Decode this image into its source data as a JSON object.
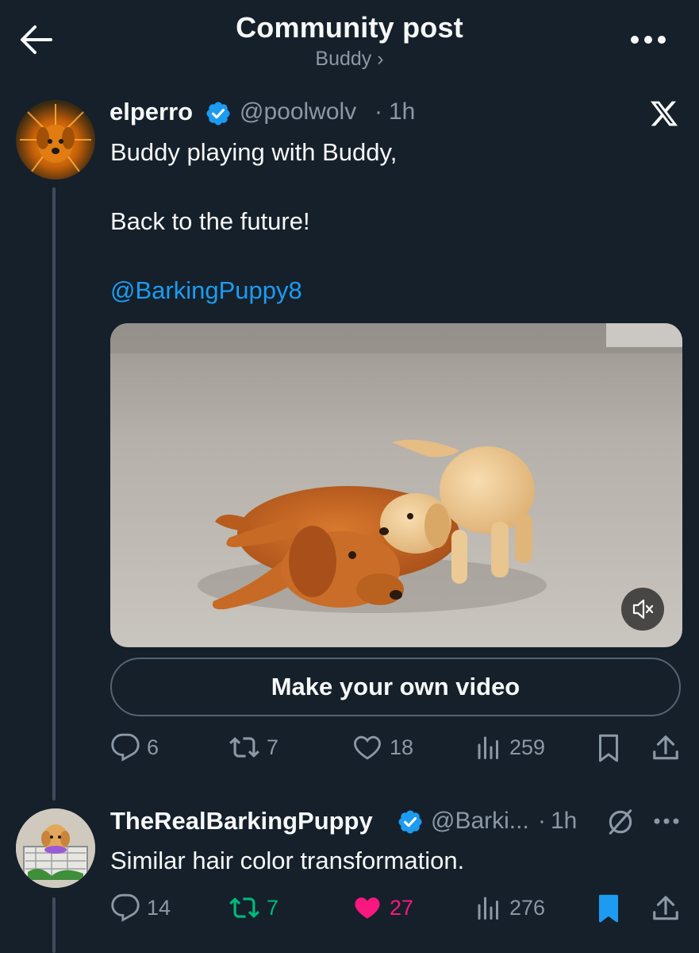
{
  "header": {
    "title": "Community post",
    "community": "Buddy ›"
  },
  "post": {
    "display_name": "elperro",
    "handle": "@poolwolv",
    "separator": "·",
    "time": "1h",
    "text_line1": "Buddy playing with Buddy,",
    "text_line2": "Back to the future!",
    "mention": "@BarkingPuppy8",
    "cta_label": "Make your own video",
    "stats": {
      "replies": "6",
      "reposts": "7",
      "likes": "18",
      "views": "259"
    }
  },
  "reply": {
    "display_name": "TheRealBarkingPuppy",
    "handle": "@Barki...",
    "separator": "·",
    "time": "1h",
    "text": "Similar hair color transformation.",
    "stats": {
      "replies": "14",
      "reposts": "7",
      "likes": "27",
      "views": "276"
    }
  },
  "colors": {
    "background": "#15202b",
    "link": "#1d9bf0",
    "verified": "#1d9bf0",
    "repost_active": "#00ba7c",
    "like_active": "#f91880",
    "muted": "#8b98a5"
  },
  "icons": [
    "back-arrow-icon",
    "more-icon",
    "verified-icon",
    "x-logo-icon",
    "mute-icon",
    "reply-icon",
    "repost-icon",
    "like-icon",
    "views-icon",
    "bookmark-icon",
    "share-icon",
    "grok-icon"
  ]
}
